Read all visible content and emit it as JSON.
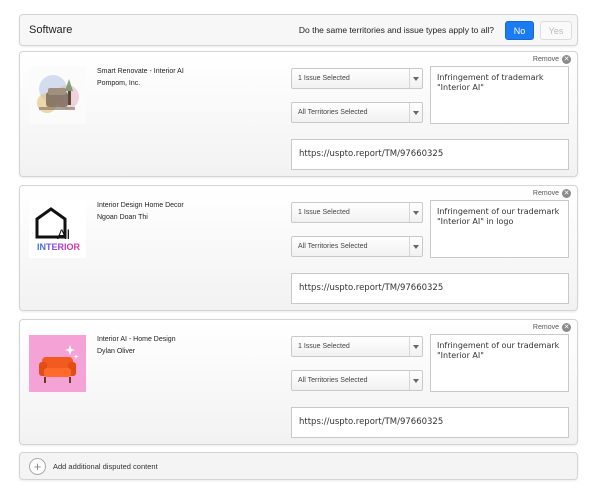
{
  "header": {
    "title": "Software",
    "question": "Do the same territories and issue types apply to all?",
    "no_label": "No",
    "yes_label": "Yes"
  },
  "items": [
    {
      "remove_label": "Remove",
      "app_name": "Smart Renovate - Interior AI",
      "developer": "Pompom, Inc.",
      "issue_select": "1 Issue Selected",
      "territory_select": "All Territories Selected",
      "description": "Infringement of trademark \"Interior AI\"",
      "url": "https://uspto.report/TM/97660325",
      "icon": "watercolor-room-icon"
    },
    {
      "remove_label": "Remove",
      "app_name": "Interior Design Home Decor",
      "developer": "Ngoan Doan Thi",
      "issue_select": "1 Issue Selected",
      "territory_select": "All Territories Selected",
      "description": "Infringement of our trademark \"Interior AI\" in logo",
      "url": "https://uspto.report/TM/97660325",
      "icon": "house-ai-logo-icon",
      "logo_text_top": "AI",
      "logo_text_bottom": "INTERIOR"
    },
    {
      "remove_label": "Remove",
      "app_name": "Interior AI - Home Design",
      "developer": "Dylan Oliver",
      "issue_select": "1 Issue Selected",
      "territory_select": "All Territories Selected",
      "description": "Infringement of our trademark \"Interior AI\"",
      "url": "https://uspto.report/TM/97660325",
      "icon": "orange-armchair-icon"
    }
  ],
  "add_label": "Add additional disputed content",
  "colors": {
    "accent": "#1a7cf0",
    "card_border": "#d4d4d4"
  }
}
